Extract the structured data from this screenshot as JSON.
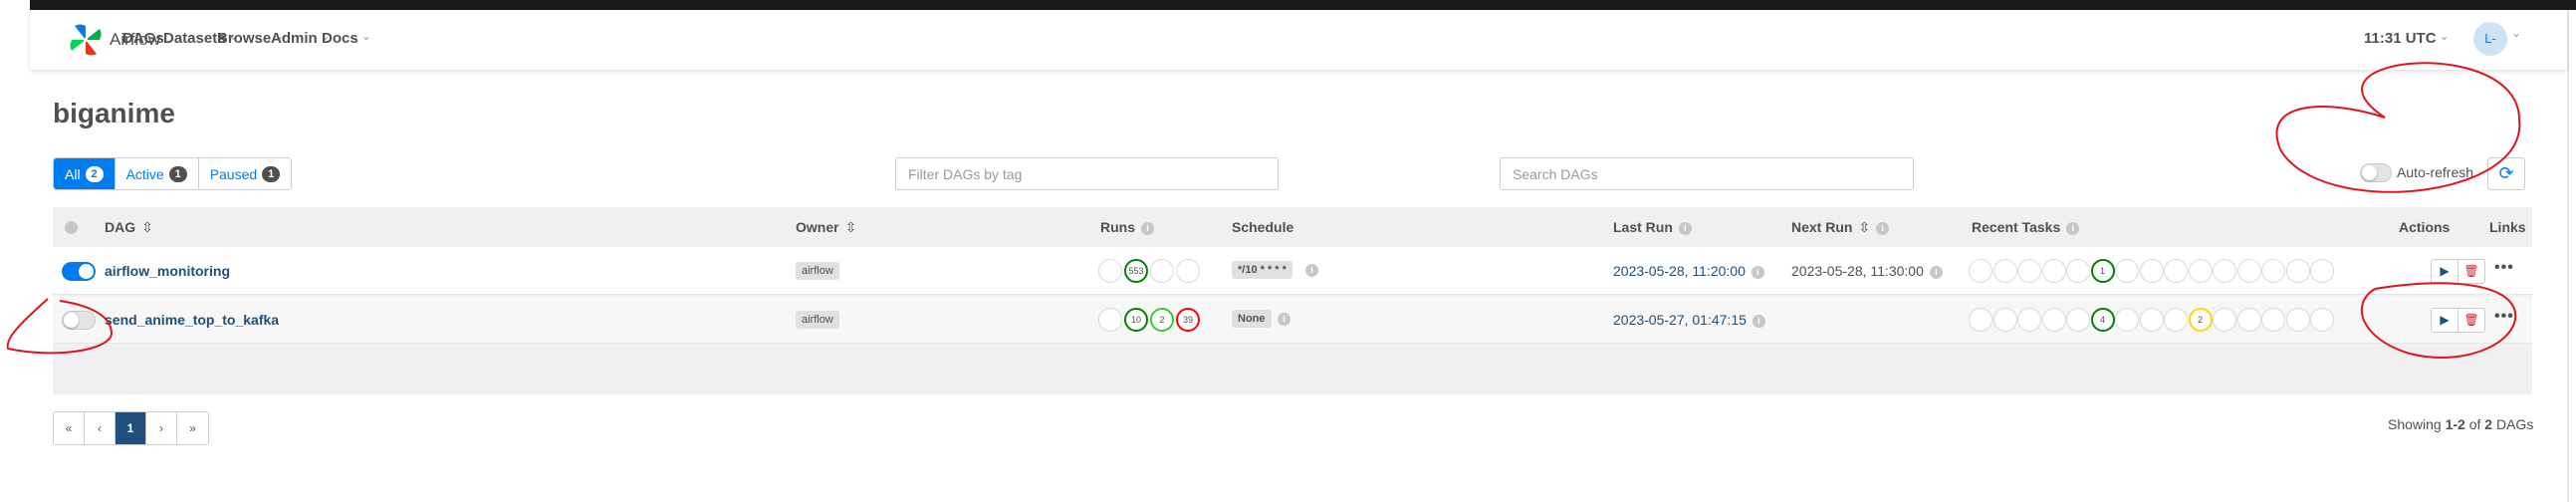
{
  "brand": {
    "name": "Airflow"
  },
  "nav": {
    "dags": "DAGs",
    "datasets": "Datasets",
    "browse": "Browse",
    "admin": "Admin",
    "docs": "Docs"
  },
  "header": {
    "time": "11:31 UTC",
    "user_initials": "L-"
  },
  "page": {
    "title": "biganime"
  },
  "tabs": {
    "all": {
      "label": "All",
      "count": "2"
    },
    "active": {
      "label": "Active",
      "count": "1"
    },
    "paused": {
      "label": "Paused",
      "count": "1"
    }
  },
  "filters": {
    "tag_placeholder": "Filter DAGs by tag",
    "search_placeholder": "Search DAGs"
  },
  "autorefresh": {
    "label": "Auto-refresh",
    "enabled": false
  },
  "columns": {
    "dag": "DAG",
    "owner": "Owner",
    "runs": "Runs",
    "schedule": "Schedule",
    "last_run": "Last Run",
    "next_run": "Next Run",
    "recent_tasks": "Recent Tasks",
    "actions": "Actions",
    "links": "Links"
  },
  "dags": [
    {
      "dag_id": "airflow_monitoring",
      "enabled": true,
      "owner": "airflow",
      "runs": [
        "",
        "553",
        "",
        ""
      ],
      "schedule": "*/10 * * * *",
      "last_run": "2023-05-28, 11:20:00",
      "next_run": "2023-05-28, 11:30:00",
      "recent_task_count": "1"
    },
    {
      "dag_id": "send_anime_top_to_kafka",
      "enabled": false,
      "owner": "airflow",
      "runs": [
        "",
        "10",
        "2",
        "39"
      ],
      "schedule": "None",
      "last_run": "2023-05-27, 01:47:15",
      "next_run": "",
      "recent_task_count_a": "4",
      "recent_task_count_b": "2"
    }
  ],
  "pagination": {
    "first": "«",
    "prev": "‹",
    "current": "1",
    "next": "›",
    "last": "»"
  },
  "footer": {
    "showing_prefix": "Showing",
    "range": "1-2",
    "of": "of",
    "total": "2",
    "suffix": "DAGs"
  },
  "icons": {
    "info": "i",
    "sort": "⇳",
    "play": "▶",
    "delete": "🗑",
    "refresh": "⟳",
    "links": "•••"
  },
  "colors": {
    "accent": "#017cee",
    "dag_link": "#1f4f7a",
    "success": "#008000",
    "running": "#32cd32",
    "failed": "#ff0000",
    "up_for_retry": "#ffd700",
    "annotation": "#e0141e"
  }
}
